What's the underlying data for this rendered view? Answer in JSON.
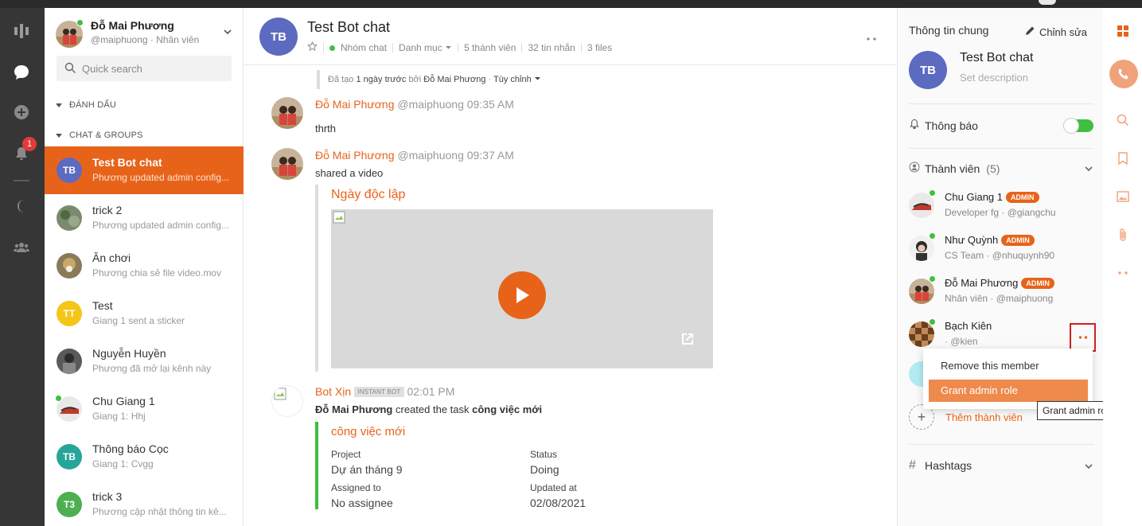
{
  "me": {
    "name": "Đỗ Mai Phương",
    "sub": "@maiphuong · Nhân viên"
  },
  "search": {
    "placeholder": "Quick search"
  },
  "sections": {
    "starred": "ĐÁNH DẤU",
    "chats": "CHAT & GROUPS"
  },
  "rail": {
    "notification_count": "1"
  },
  "conversations": [
    {
      "initials": "TB",
      "name": "Test Bot chat",
      "preview": "Phương updated admin config...",
      "color": "#5c6bc0"
    },
    {
      "initials": "",
      "name": "trick 2",
      "preview": "Phương updated admin config...",
      "color": "#7a8a6e"
    },
    {
      "initials": "",
      "name": "Ăn chơi",
      "preview": "Phương chia sẻ file video.mov",
      "color": "#8a7a5a"
    },
    {
      "initials": "TT",
      "name": "Test",
      "preview": "Giang 1 sent a sticker",
      "color": "#f5c518"
    },
    {
      "initials": "",
      "name": "Nguyễn Huyền",
      "preview": "Phương đã mở lại kênh này",
      "color": "#6e6e6e"
    },
    {
      "initials": "",
      "name": "Chu Giang 1",
      "preview": "Giang 1: Hhj",
      "color": "#c0504d"
    },
    {
      "initials": "TB",
      "name": "Thông báo Cọc",
      "preview": "Giang 1: Cvgg",
      "color": "#26a69a"
    },
    {
      "initials": "T3",
      "name": "trick 3",
      "preview": "Phương cập nhật thông tin kê...",
      "color": "#4caf50"
    }
  ],
  "chat": {
    "initials": "TB",
    "title": "Test Bot chat",
    "type": "Nhóm chat",
    "category": "Danh mục",
    "members": "5 thành viên",
    "messages": "32 tin nhắn",
    "files": "3 files",
    "created_prefix": "Đã tạo",
    "created_ago": "1 ngày trước",
    "created_by_label": "bởi",
    "created_by": "Đỗ Mai Phương",
    "customize": "Tùy chỉnh"
  },
  "messages": [
    {
      "name": "Đỗ Mai Phương",
      "handle": "@maiphuong",
      "time": "09:35 AM",
      "text": "thrth"
    },
    {
      "name": "Đỗ Mai Phương",
      "handle": "@maiphuong",
      "time": "09:37 AM",
      "text": "shared a video",
      "video_title": "Ngày độc lập"
    },
    {
      "name": "Bot Xịn",
      "tag": "INSTANT BOT",
      "time": "02:01 PM",
      "actor": "Đỗ Mai Phương",
      "action": "created the task",
      "task_name": "công việc mới"
    }
  ],
  "task": {
    "title": "công việc mới",
    "project_label": "Project",
    "project": "Dự án tháng 9",
    "status_label": "Status",
    "status": "Doing",
    "assigned_label": "Assigned to",
    "assigned": "No assignee",
    "updated_label": "Updated at",
    "updated": "02/08/2021"
  },
  "info": {
    "title": "Thông tin chung",
    "edit": "Chỉnh sửa",
    "group_initials": "TB",
    "group_name": "Test Bot chat",
    "description": "Set description",
    "notifications": "Thông báo",
    "members_label": "Thành viên",
    "members_count": "(5)",
    "hashtags": "Hashtags",
    "add_member": "Thêm thành viên",
    "admin_badge": "ADMIN"
  },
  "members": [
    {
      "name": "Chu Giang 1",
      "sub": "Developer fg · @giangchu",
      "admin": true
    },
    {
      "name": "Như Quỳnh",
      "sub": "CS Team · @nhuquynh90",
      "admin": true
    },
    {
      "name": "Đỗ Mai Phương",
      "sub": "Nhân viên · @maiphuong",
      "admin": true
    },
    {
      "name": "Bạch Kiên",
      "sub": "· @kien",
      "admin": false
    }
  ],
  "member_menu": {
    "remove": "Remove this member",
    "grant": "Grant admin role"
  },
  "tooltip": "Grant admin role",
  "colors": {
    "accent": "#e8631a",
    "online": "#3fbf3f",
    "rail": "#363636",
    "group_avatar": "#5c6bc0"
  }
}
